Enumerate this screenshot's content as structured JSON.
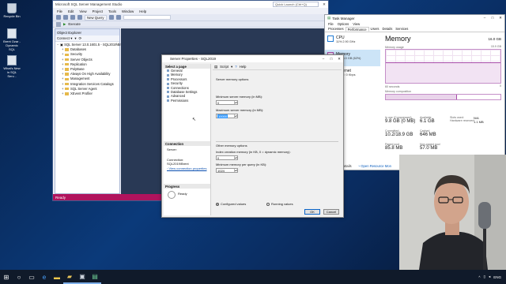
{
  "desktop": {
    "icons": [
      {
        "label": "Recycle Bin",
        "icon": "recycle-bin-icon"
      },
      {
        "label": "Brent Ozar - Dynamic SQL",
        "icon": "document-icon"
      },
      {
        "label": "What's New in SQL Serv...",
        "icon": "document-icon"
      }
    ]
  },
  "ssms": {
    "title": "Microsoft SQL Server Management Studio",
    "quick_launch_placeholder": "Quick Launch (Ctrl+Q)",
    "menu": [
      "File",
      "Edit",
      "View",
      "Project",
      "Tools",
      "Window",
      "Help"
    ],
    "toolbar": {
      "new_query": "New Query",
      "execute": "Execute"
    },
    "object_explorer": {
      "title": "Object Explorer",
      "connect_label": "Connect ▾",
      "root": "SQL Server 13.0.1601.5 - SQL2019\\Brent",
      "nodes": [
        "Databases",
        "Security",
        "Server Objects",
        "Replication",
        "PolyBase",
        "Always On High Availability",
        "Management",
        "Integration Services Catalogs",
        "SQL Server Agent",
        "XEvent Profiler"
      ]
    },
    "status": "Ready"
  },
  "server_properties": {
    "title": "Server Properties - SQL2019",
    "select_page_header": "Select a page",
    "pages": [
      "General",
      "Memory",
      "Processors",
      "Security",
      "Connections",
      "Database Settings",
      "Advanced",
      "Permissions"
    ],
    "script_label": "Script",
    "help_label": "Help",
    "server_memory_options": "Server memory options",
    "min_memory_label": "Minimum server memory (in MB):",
    "min_memory_value": "0",
    "max_memory_label": "Maximum server memory (in MB):",
    "max_memory_value": "10000",
    "other_memory_options": "Other memory options",
    "index_memory_label": "Index creation memory (in KB, 0 = dynamic memory):",
    "index_memory_value": "0",
    "min_query_memory_label": "Minimum memory per query (in KB):",
    "min_query_memory_value": "1024",
    "connection_header": "Connection",
    "server_label": "Server:",
    "connection_label": "Connection:",
    "connection_value": "SQL2019\\Brent",
    "view_connection_link": "View connection properties",
    "progress_header": "Progress",
    "progress_status": "Ready",
    "configured_values": "Configured values",
    "running_values": "Running values",
    "ok": "OK",
    "cancel": "Cancel"
  },
  "task_manager": {
    "title": "Task Manager",
    "menu": [
      "File",
      "Options",
      "View"
    ],
    "tabs": [
      "Processes",
      "Performance",
      "Users",
      "Details",
      "Services"
    ],
    "active_tab": "Performance",
    "resources": [
      {
        "name": "CPU",
        "detail": "11% 2.90 GHz",
        "color": "#1f7ad3"
      },
      {
        "name": "Memory",
        "detail": "9.8/16.0 GB (62%)",
        "color": "#a74ba9"
      },
      {
        "name": "Ethernet",
        "detail": "S: 0 R: 0 Kbps",
        "color": "#b3742a"
      }
    ],
    "memory_title": "Memory",
    "memory_capacity": "16.0 GB",
    "memory_usage_label": "Memory usage",
    "memory_usage_max": "15.9 GB",
    "graph_left": "60 seconds",
    "graph_right": "0",
    "composition_label": "Memory composition",
    "memory_fraction": 0.62,
    "stats": {
      "in_use_label": "In use (Compressed)",
      "in_use": "9.8 GB (0 MB)",
      "available_label": "Available",
      "available": "6.1 GB",
      "slots_label": "Slots used:",
      "slots": "N/A",
      "reserved_label": "Hardware reserved:",
      "reserved": "1.1 MB",
      "committed_label": "Committed",
      "committed": "10.2/18.9 GB",
      "cached_label": "Cached",
      "cached": "646 MB",
      "paged_label": "Paged pool",
      "paged": "85.8 MB",
      "nonpaged_label": "Non-paged pool",
      "nonpaged": "57.0 MB"
    },
    "fewer_details": "Fewer details",
    "open_resource_monitor": "Open Resource Mon"
  },
  "taskbar": {
    "apps": [
      "start-icon",
      "search-icon",
      "task-view-icon",
      "edge-icon",
      "file-explorer-icon",
      "ssms-icon",
      "terminal-icon",
      "task-manager-icon"
    ],
    "tray_text": "ENG"
  }
}
